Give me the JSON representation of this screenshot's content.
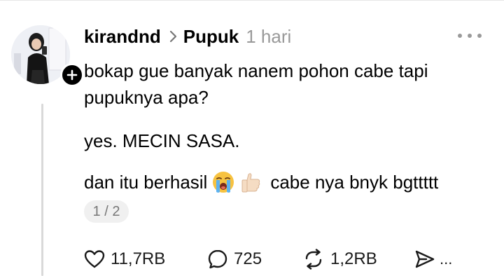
{
  "post": {
    "username": "kirandnd",
    "topic": "Pupuk",
    "time": "1 hari",
    "lines": [
      "bokap gue banyak nanem pohon cabe tapi",
      "pupuknya apa?",
      "yes. MECIN SASA.",
      "dan itu berhasil",
      "cabe nya bnyk bgttttt"
    ],
    "emojis": [
      "loudly-crying-face",
      "thumbs-up-light-skin-tone"
    ],
    "pager": "1 / 2"
  },
  "actions": {
    "likes": "11,7RB",
    "replies": "725",
    "reposts": "1,2RB",
    "share_more": "..."
  },
  "colors": {
    "text": "#000000",
    "muted": "#999999",
    "icon": "#1a1a1a",
    "thread_line": "#d9d9d9",
    "pager_bg": "#f0f0f0"
  }
}
